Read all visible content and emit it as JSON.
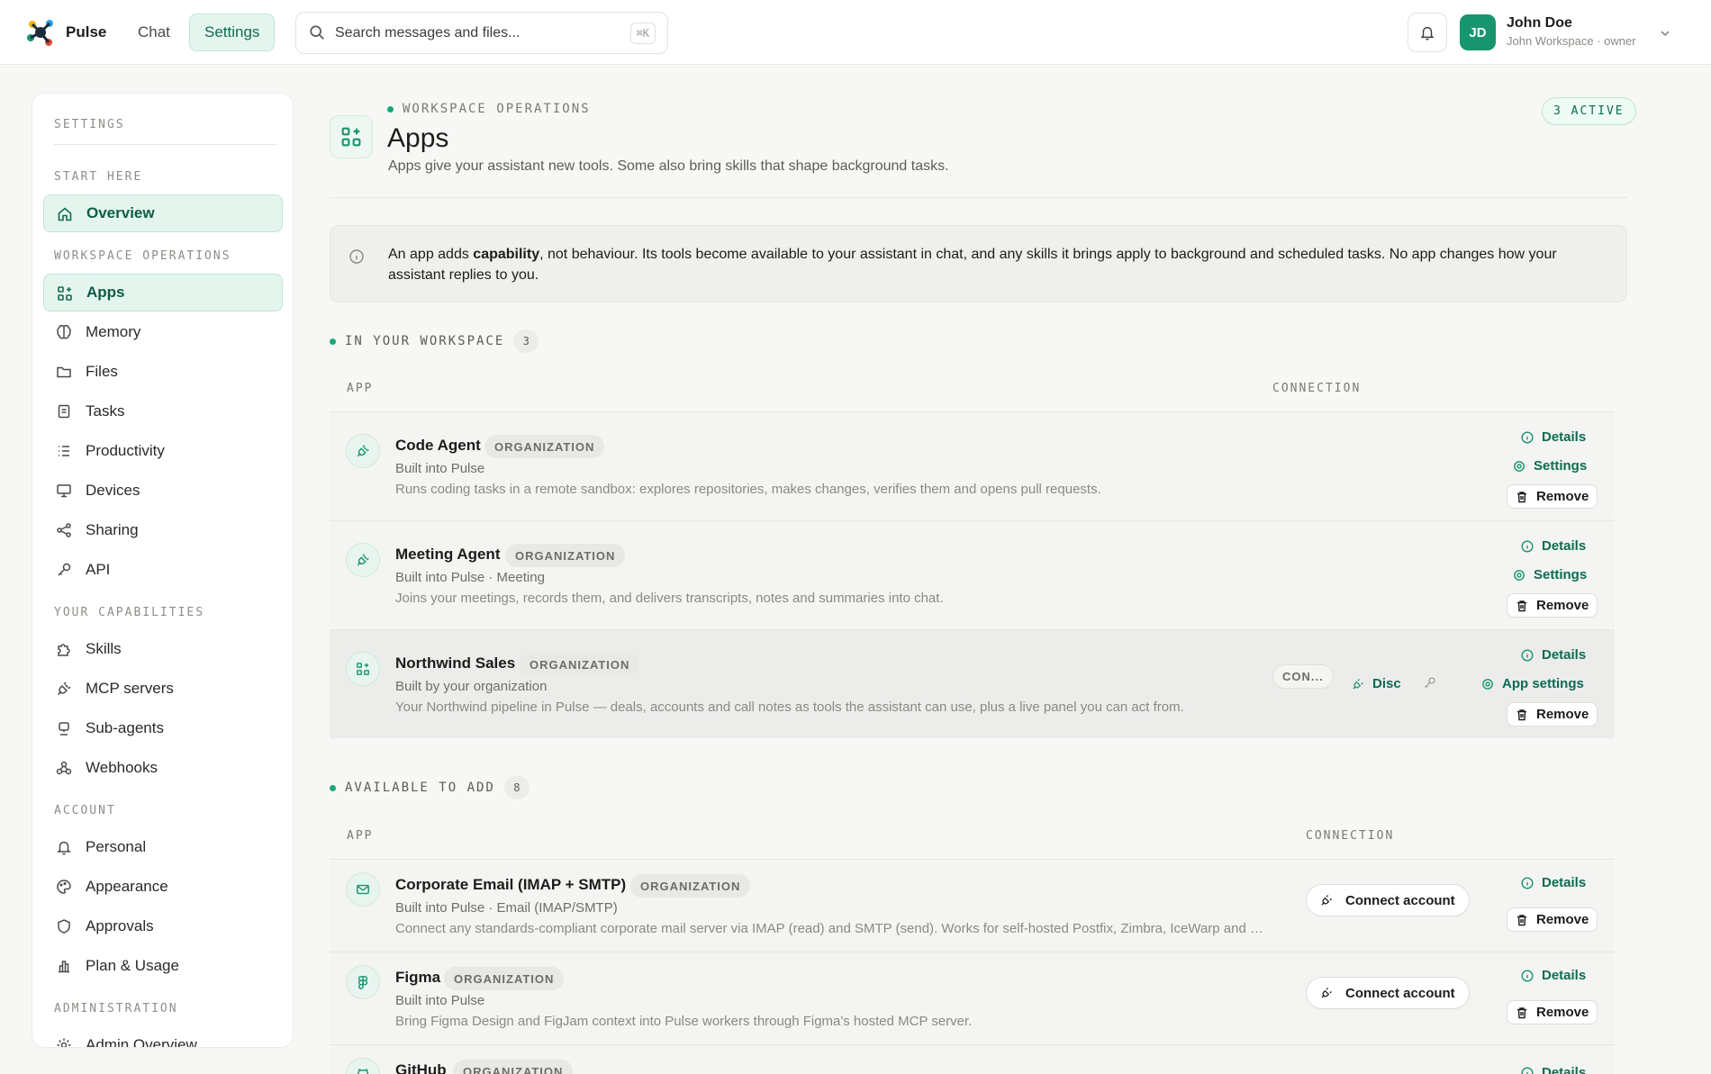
{
  "topbar": {
    "brand": "Pulse",
    "nav": {
      "chat": "Chat",
      "settings": "Settings"
    },
    "search_placeholder": "Search messages and files...",
    "search_shortcut": "⌘K",
    "user": {
      "initials": "JD",
      "name": "John Doe",
      "org": "John Workspace · owner"
    }
  },
  "sidebar": {
    "title": "SETTINGS",
    "sections": {
      "start": "START HERE",
      "workspace": "WORKSPACE OPERATIONS",
      "capabilities": "YOUR CAPABILITIES",
      "account": "ACCOUNT",
      "admin": "ADMINISTRATION"
    },
    "items": {
      "overview": "Overview",
      "apps": "Apps",
      "memory": "Memory",
      "files": "Files",
      "tasks": "Tasks",
      "productivity": "Productivity",
      "devices": "Devices",
      "sharing": "Sharing",
      "api": "API",
      "skills": "Skills",
      "mcp": "MCP servers",
      "subagents": "Sub-agents",
      "webhooks": "Webhooks",
      "personal": "Personal",
      "appearance": "Appearance",
      "approvals": "Approvals",
      "plan": "Plan & Usage",
      "admin_overview": "Admin Overview"
    }
  },
  "header": {
    "eyebrow": "WORKSPACE OPERATIONS",
    "title": "Apps",
    "subtitle": "Apps give your assistant new tools. Some also bring skills that shape background tasks.",
    "active_badge": "3 ACTIVE"
  },
  "note": {
    "pre": "An app adds ",
    "bold": "capability",
    "post": ", not behaviour. Its tools become available to your assistant in chat, and any skills it brings apply to background and scheduled tasks. No app changes how your assistant replies to you."
  },
  "installed": {
    "title": "IN YOUR WORKSPACE",
    "count": "3",
    "col_app": "APP",
    "col_connection": "CONNECTION",
    "apps": [
      {
        "name": "Code Agent",
        "badge": "ORGANIZATION",
        "source": "Built into Pulse",
        "desc": "Runs coding tasks in a remote sandbox: explores repositories, makes changes, verifies them and opens pull requests.",
        "details": "Details",
        "settings": "Settings",
        "remove": "Remove"
      },
      {
        "name": "Meeting Agent",
        "badge": "ORGANIZATION",
        "source": "Built into Pulse · Meeting",
        "desc": "Joins your meetings, records them, and delivers transcripts, notes and summaries into chat.",
        "details": "Details",
        "settings": "Settings",
        "remove": "Remove"
      },
      {
        "name": "Northwind Sales",
        "badge": "ORGANIZATION",
        "source": "Built by your organization",
        "desc": "Your Northwind pipeline in Pulse — deals, accounts and call notes as tools the assistant can use, plus a live panel you can act from.",
        "connection_status": "CON...",
        "disconnect": "Disc",
        "details": "Details",
        "settings": "App settings",
        "remove": "Remove"
      }
    ]
  },
  "available": {
    "title": "AVAILABLE TO ADD",
    "count": "8",
    "col_app": "APP",
    "col_connection": "CONNECTION",
    "apps": [
      {
        "name": "Corporate Email (IMAP + SMTP)",
        "badge": "ORGANIZATION",
        "source": "Built into Pulse · Email (IMAP/SMTP)",
        "desc": "Connect any standards-compliant corporate mail server via IMAP (read) and SMTP (send). Works for self-hosted Postfix, Zimbra, IceWarp and others.",
        "connect": "Connect account",
        "details": "Details",
        "remove": "Remove"
      },
      {
        "name": "Figma",
        "badge": "ORGANIZATION",
        "source": "Built into Pulse",
        "desc": "Bring Figma Design and FigJam context into Pulse workers through Figma's hosted MCP server.",
        "connect": "Connect account",
        "details": "Details",
        "remove": "Remove"
      },
      {
        "name": "GitHub",
        "badge": "ORGANIZATION",
        "details": "Details"
      }
    ]
  },
  "colors": {
    "accent": "#17956e",
    "accent_text": "#0e6b52",
    "accent_bg": "#e4f5ee"
  }
}
